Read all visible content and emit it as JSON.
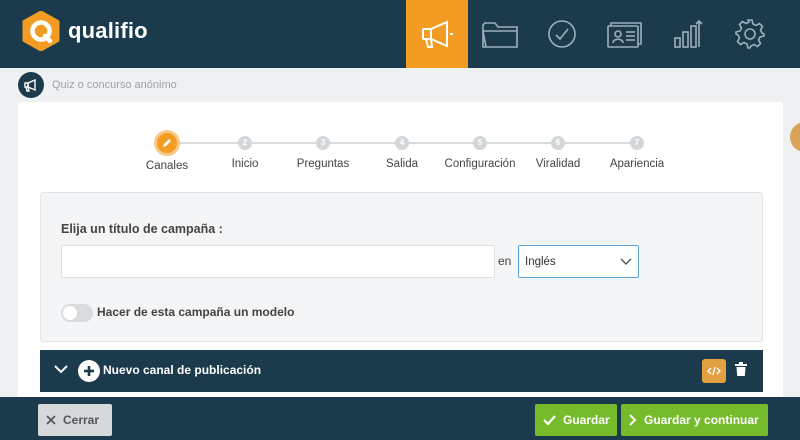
{
  "brand": {
    "name": "qualifio"
  },
  "nav": [
    {
      "icon": "megaphone-icon",
      "active": true
    },
    {
      "icon": "folder-icon",
      "active": false
    },
    {
      "icon": "check-circle-icon",
      "active": false
    },
    {
      "icon": "contacts-cards-icon",
      "active": false
    },
    {
      "icon": "bar-chart-icon",
      "active": false
    },
    {
      "icon": "gear-icon",
      "active": false
    }
  ],
  "breadcrumb": {
    "icon": "megaphone-icon",
    "text": "Quiz o concurso anónimo"
  },
  "steps": [
    {
      "number": "",
      "label": "Canales",
      "active": true
    },
    {
      "number": "2",
      "label": "Inicio",
      "active": false
    },
    {
      "number": "3",
      "label": "Preguntas",
      "active": false
    },
    {
      "number": "4",
      "label": "Salida",
      "active": false
    },
    {
      "number": "5",
      "label": "Configuración",
      "active": false
    },
    {
      "number": "6",
      "label": "Viralidad",
      "active": false
    },
    {
      "number": "7",
      "label": "Apariencia",
      "active": false
    }
  ],
  "form": {
    "title_label": "Elija un título de campaña :",
    "title_value": "",
    "language_prefix": "en",
    "language_selected": "Inglés",
    "template_toggle_label": "Hacer de esta campaña un modelo",
    "template_toggle_on": false
  },
  "channel": {
    "label": "Nuevo canal de publicación",
    "code_icon": "code-icon",
    "delete_icon": "trash-icon"
  },
  "footer": {
    "close_label": "Cerrar",
    "save_label": "Guardar",
    "save_continue_label": "Guardar y continuar"
  },
  "colors": {
    "navy": "#1b3a4b",
    "orange": "#f39c23",
    "green": "#75bb2c"
  }
}
